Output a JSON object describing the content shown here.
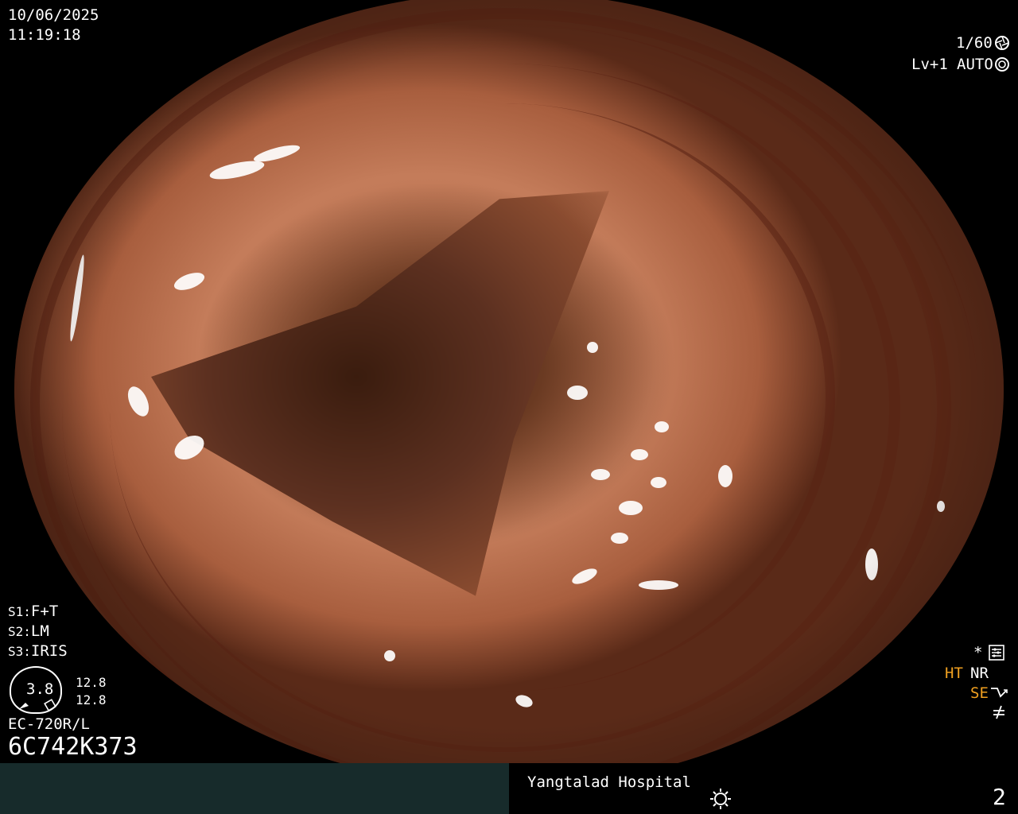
{
  "header": {
    "date": "10/06/2025",
    "time": "11:19:18",
    "shutter": "1/60",
    "level": "Lv+1",
    "mode": "AUTO"
  },
  "settings": {
    "s1_key": "S1:",
    "s1_val": "F+T",
    "s2_key": "S2:",
    "s2_val": "LM",
    "s3_key": "S3:",
    "s3_val": "IRIS"
  },
  "gauge": {
    "value": "3.8",
    "top_reading": "12.8",
    "bottom_reading": "12.8"
  },
  "scope": {
    "model": "EC-720R/L",
    "serial": "6C742K373"
  },
  "processing": {
    "ht": "HT",
    "nr": "NR",
    "se": "SE"
  },
  "footer": {
    "hospital": "Yangtalad Hospital",
    "page_number": "2"
  },
  "icons": {
    "shutter": "aperture-icon",
    "auto": "iris-icon",
    "menu": "settings-panel-icon",
    "se": "enhance-icon",
    "freeze": "not-equal-icon",
    "light": "sun-icon"
  },
  "colors": {
    "accent": "#f0a020",
    "footer_bar": "#172b2b"
  }
}
